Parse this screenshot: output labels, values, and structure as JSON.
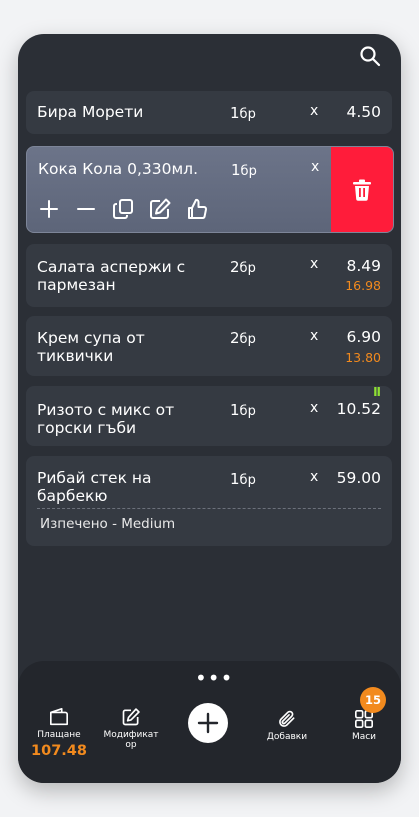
{
  "icons": {
    "search": "search-icon",
    "delete": "trash-icon",
    "actions": [
      "plus-icon",
      "minus-icon",
      "copy-icon",
      "edit-icon",
      "thumbs-up-icon"
    ],
    "status": "pause-icon",
    "nav": [
      "wallet-icon",
      "edit-icon",
      "plus-icon",
      "paperclip-icon",
      "grid-icon"
    ]
  },
  "colors": {
    "background": "#2b2f36",
    "card": "#353a42",
    "selected": "#646c80",
    "delete": "#ff1c3a",
    "accent": "#f28a1e",
    "status": "#8fe034"
  },
  "order": {
    "items": [
      {
        "name": "Бира Морети",
        "qty": "1",
        "unit": "бр",
        "x": "x",
        "price": "4.50",
        "subtotal": ""
      },
      {
        "name": "Кока Кола 0,330мл.",
        "qty": "1",
        "unit": "бр",
        "x": "x",
        "price": "",
        "subtotal": ""
      },
      {
        "name": "Салата аспержи с пармезан",
        "qty": "2",
        "unit": "бр",
        "x": "x",
        "price": "8.49",
        "subtotal": "16.98"
      },
      {
        "name": "Крем супа от тиквички",
        "qty": "2",
        "unit": "бр",
        "x": "x",
        "price": "6.90",
        "subtotal": "13.80"
      },
      {
        "name": "Ризото с микс от горски гъби",
        "qty": "1",
        "unit": "бр",
        "x": "x",
        "price": "10.52",
        "subtotal": "",
        "status": "II"
      },
      {
        "name": "Рибай стек на барбекю",
        "qty": "1",
        "unit": "бр",
        "x": "x",
        "price": "59.00",
        "subtotal": "",
        "modifier": "Изпечено - Medium"
      }
    ]
  },
  "bottom_bar": {
    "more": "•••",
    "payment": {
      "label": "Плащане",
      "total": "107.48"
    },
    "modifier": {
      "label": "Модификатор"
    },
    "addons": {
      "label": "Добавки"
    },
    "tables": {
      "label": "Маси",
      "badge": "15"
    }
  }
}
